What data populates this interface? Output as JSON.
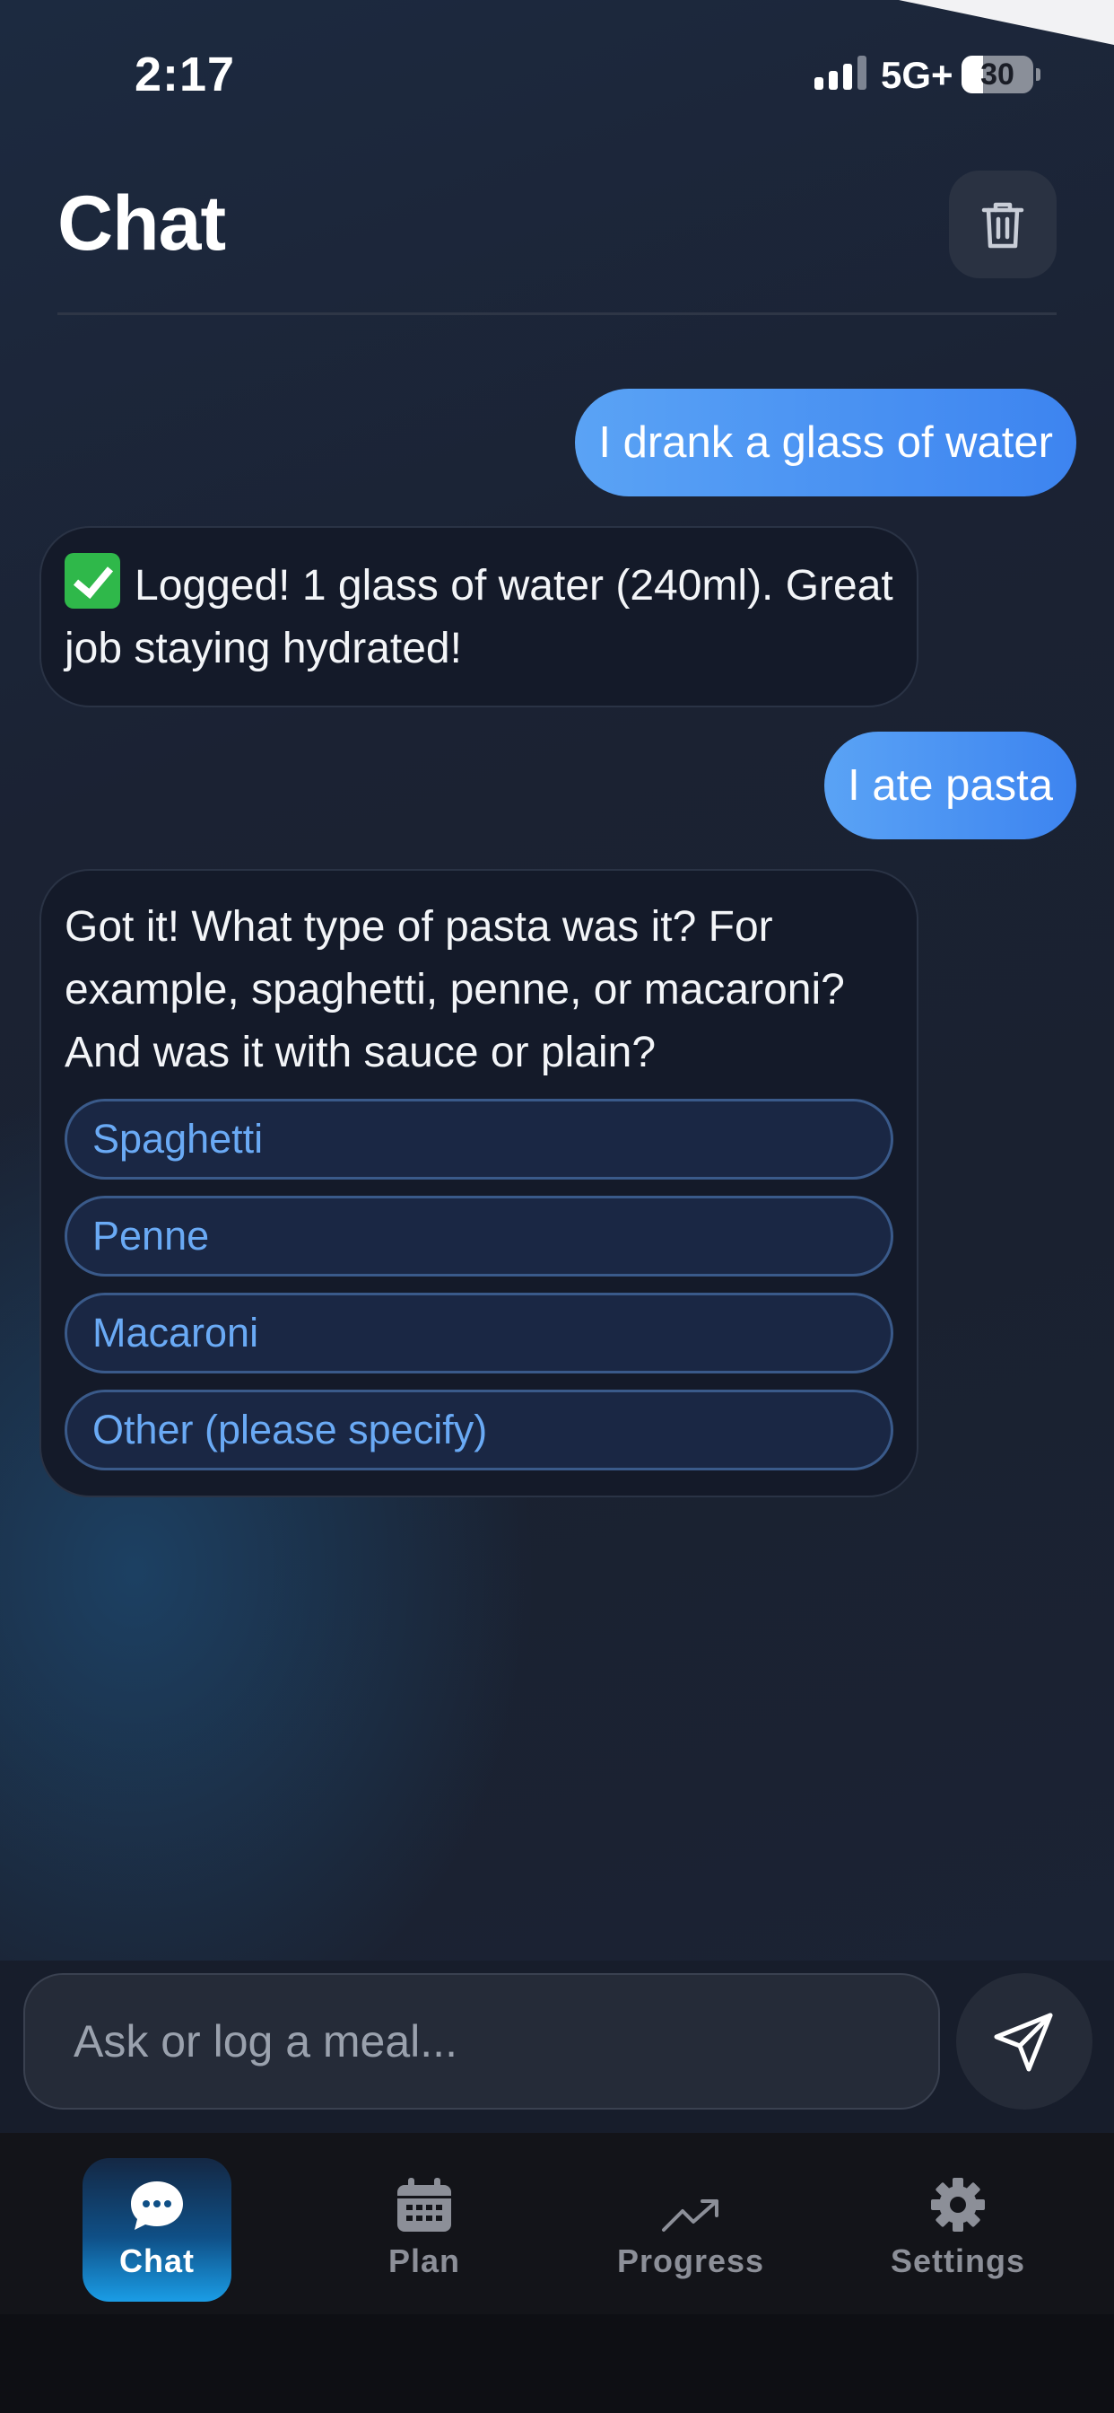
{
  "status_bar": {
    "time": "2:17",
    "network": "5G+",
    "battery": "30",
    "battery_level": 0.3
  },
  "header": {
    "title": "Chat",
    "clear_icon": "trash-icon"
  },
  "messages": [
    {
      "role": "user",
      "text": "I drank a glass of water"
    },
    {
      "role": "assistant",
      "icon": "check-mark-emoji",
      "text": "Logged! 1 glass of water (240ml). Great job staying hydrated!"
    },
    {
      "role": "user",
      "text": "I ate pasta"
    },
    {
      "role": "assistant",
      "text": "Got it! What type of pasta was it? For example, spaghetti, penne, or macaroni? And was it with sauce or plain?",
      "options": [
        "Spaghetti",
        "Penne",
        "Macaroni",
        "Other (please specify)"
      ]
    }
  ],
  "input": {
    "placeholder": "Ask or log a meal...",
    "send_icon": "send-icon"
  },
  "tabs": [
    {
      "label": "Chat",
      "icon": "chat-bubble-icon",
      "active": true
    },
    {
      "label": "Plan",
      "icon": "calendar-icon",
      "active": false
    },
    {
      "label": "Progress",
      "icon": "trend-up-icon",
      "active": false
    },
    {
      "label": "Settings",
      "icon": "gear-icon",
      "active": false
    }
  ],
  "colors": {
    "user_bubble": "#4a93f2",
    "option_text": "#6aaaf5",
    "active_tab": "#1a9de6"
  }
}
